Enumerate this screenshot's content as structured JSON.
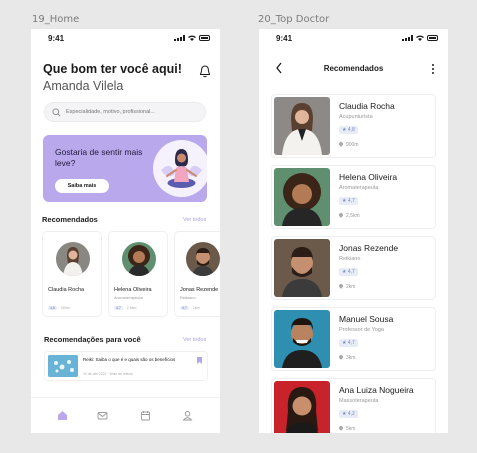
{
  "frames": {
    "home_label": "19_Home",
    "doctor_label": "20_Top Doctor"
  },
  "status_time": "9:41",
  "home": {
    "greeting": "Que bom ter você aqui!",
    "user_name": "Amanda Vilela",
    "search_placeholder": "Especialidade, motivo, profissional...",
    "banner": {
      "title": "Gostaria de sentir mais leve?",
      "button": "Saiba mais"
    },
    "recommended": {
      "title": "Recomendados",
      "see_all": "Ver todos",
      "cards": [
        {
          "name": "Claudia Rocha",
          "spec": "",
          "rating": "4,8",
          "distance": "900m"
        },
        {
          "name": "Helena Oliveira",
          "spec": "Aromaterapeuta",
          "rating": "4,7",
          "distance": "2,5km"
        },
        {
          "name": "Jonas Rezende",
          "spec": "Reikiano",
          "rating": "4,7",
          "distance": "2km"
        }
      ]
    },
    "recommendations": {
      "title": "Recomendações para você",
      "see_all": "Ver todos",
      "article_title": "Reiki: Saiba o que é e quais são os benefícios",
      "article_meta": "10 de abr 2022 · 5min de leitura"
    }
  },
  "doctors": {
    "title": "Recomendados",
    "list": [
      {
        "name": "Claudia Rocha",
        "spec": "Acupunturista",
        "rating": "4,8",
        "distance": "900m"
      },
      {
        "name": "Helena Oliveira",
        "spec": "Aromaterapeuta",
        "rating": "4,7",
        "distance": "2,5km"
      },
      {
        "name": "Jonas  Rezende",
        "spec": "Reikiano",
        "rating": "4,7",
        "distance": "2km"
      },
      {
        "name": "Manuel Sousa",
        "spec": "Professor de Yoga",
        "rating": "4,7",
        "distance": "3km"
      },
      {
        "name": "Ana Luiza Nogueira",
        "spec": "Massoterapeuta",
        "rating": "4,2",
        "distance": "5km"
      }
    ]
  },
  "colors": {
    "accent": "#b9a9ec",
    "accent_text": "#a9a0d8",
    "rating_bg": "#e7ecf7"
  },
  "icons": [
    "bell-icon",
    "search-icon",
    "back-arrow-icon",
    "more-vertical-icon",
    "star-icon",
    "location-pin-icon",
    "home-icon",
    "mail-icon",
    "calendar-icon",
    "profile-icon",
    "bookmark-icon"
  ]
}
